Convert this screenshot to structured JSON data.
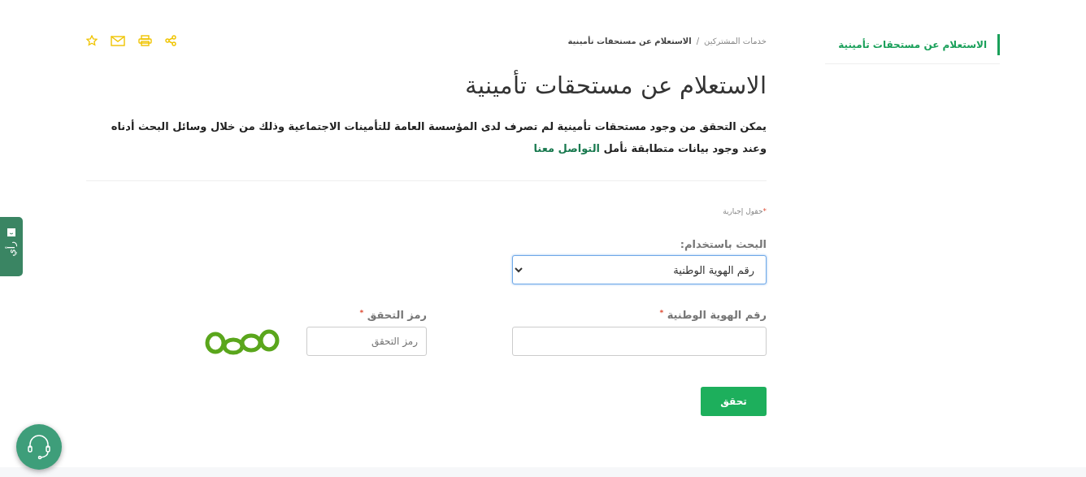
{
  "sidebar": {
    "items": [
      {
        "label": "الاستعلام عن مستحقات تأمينية",
        "selected": true
      }
    ]
  },
  "breadcrumb": {
    "separator": "/",
    "items": [
      {
        "label": "خدمات المشتركين",
        "current": false
      },
      {
        "label": "الاستعلام عن مستحقات تأمينية",
        "current": true
      }
    ]
  },
  "title": "الاستعلام عن مستحقات تأمينية",
  "description": {
    "text": "يمكن التحقق من وجود مستحقات تأمينية لم تصرف لدى المؤسسة العامة للتأمينات الاجتماعية وذلك من خلال وسائل البحث أدناه وعند وجود بيانات متطابقة نأمل",
    "link": "التواصل معنا"
  },
  "required_note": {
    "mark": "*",
    "text": "حقول إجبارية"
  },
  "search_by": {
    "label": "البحث باستخدام:",
    "value": "رقم الهوية الوطنية",
    "focused": true
  },
  "fields": [
    {
      "kind": "text",
      "label": "رقم الهوية الوطنية",
      "required_mark": "*"
    },
    {
      "kind": "captcha",
      "label": "رمز التحقق",
      "required_mark": "*",
      "placeholder": "رمز التحقق"
    }
  ],
  "submit": "تحقق",
  "feedback_tab": {
    "label": "رأي"
  }
}
